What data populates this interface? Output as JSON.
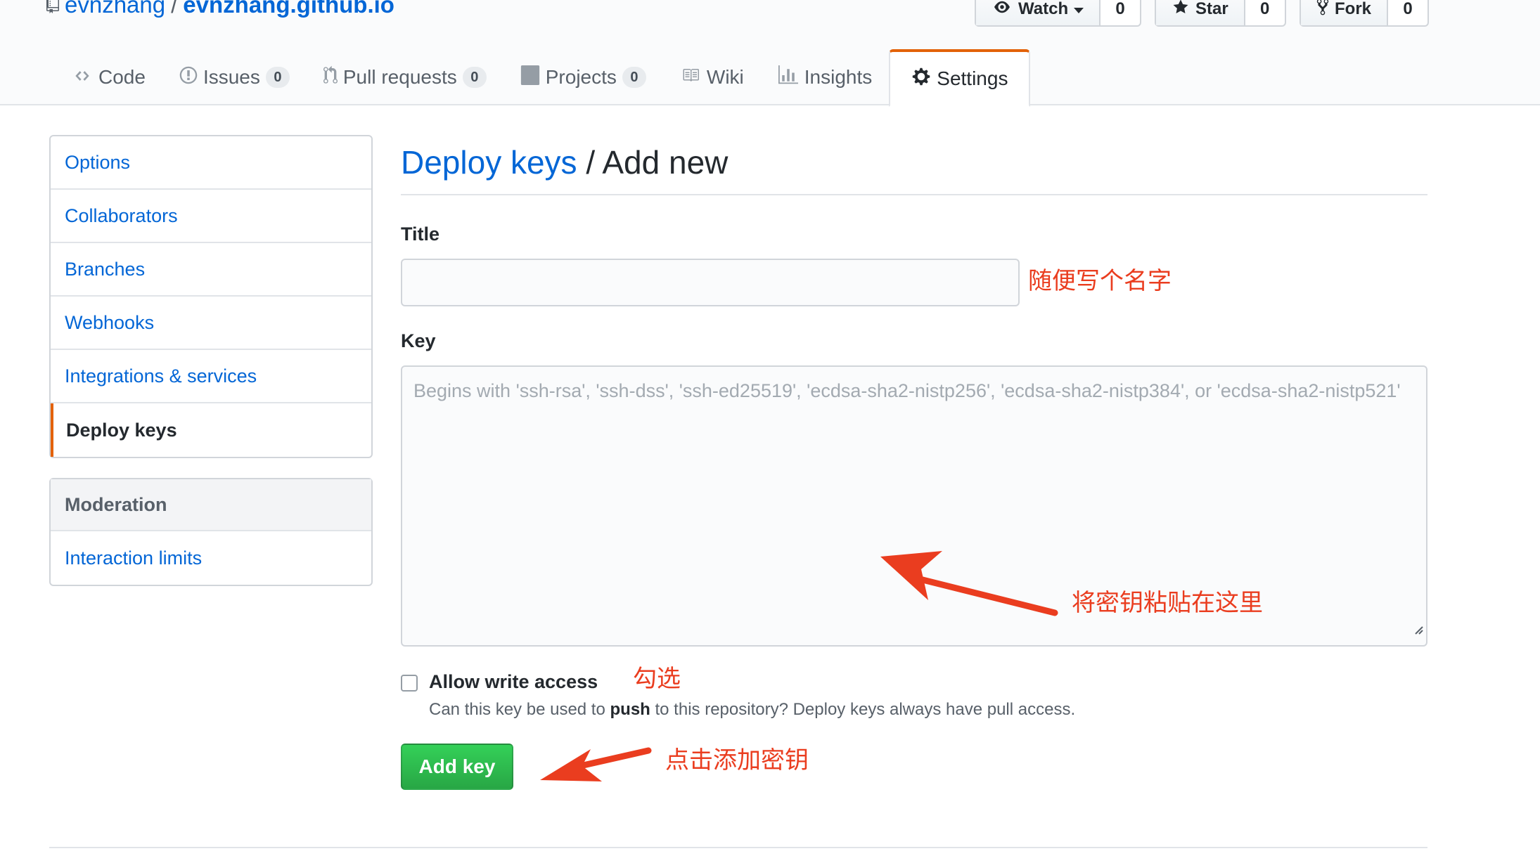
{
  "repo": {
    "owner": "evnzhang",
    "separator": "/",
    "name": "evnzhang.github.io"
  },
  "social": {
    "watch": {
      "label": "Watch",
      "count": "0"
    },
    "star": {
      "label": "Star",
      "count": "0"
    },
    "fork": {
      "label": "Fork",
      "count": "0"
    }
  },
  "tabs": [
    {
      "label": "Code"
    },
    {
      "label": "Issues",
      "count": "0"
    },
    {
      "label": "Pull requests",
      "count": "0"
    },
    {
      "label": "Projects",
      "count": "0"
    },
    {
      "label": "Wiki"
    },
    {
      "label": "Insights"
    },
    {
      "label": "Settings",
      "selected": true
    }
  ],
  "menu": {
    "items": [
      "Options",
      "Collaborators",
      "Branches",
      "Webhooks",
      "Integrations & services",
      "Deploy keys"
    ],
    "selected": "Deploy keys"
  },
  "moderation": {
    "header": "Moderation",
    "items": [
      "Interaction limits"
    ]
  },
  "page": {
    "title_link": "Deploy keys",
    "title_sep": "/",
    "title_rest": "Add new"
  },
  "form": {
    "title_label": "Title",
    "title_value": "",
    "key_label": "Key",
    "key_placeholder": "Begins with 'ssh-rsa', 'ssh-dss', 'ssh-ed25519', 'ecdsa-sha2-nistp256', 'ecdsa-sha2-nistp384', or 'ecdsa-sha2-nistp521'",
    "write_access_label": "Allow write access",
    "write_access_checked": false,
    "note_before": "Can this key be used to",
    "note_bold": "push",
    "note_after": "to this repository? Deploy keys always have pull access.",
    "submit_label": "Add key"
  },
  "annotations": {
    "title_hint": "随便写个名字",
    "key_hint": "将密钥粘贴在这里",
    "checkbox_hint": "勾选",
    "button_hint": "点击添加密钥",
    "color": "#ea3d1f"
  },
  "colors": {
    "link": "#0366d6",
    "accent": "#e36209",
    "primary_button": "#28a745"
  }
}
